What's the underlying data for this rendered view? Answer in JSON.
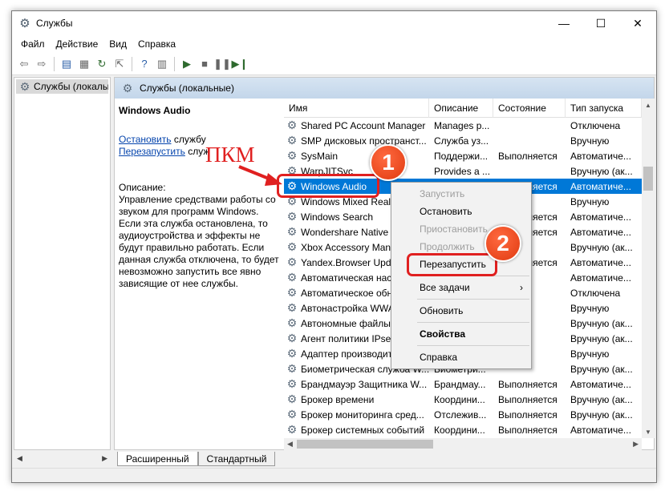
{
  "window": {
    "title": "Службы",
    "controls": {
      "minimize": "—",
      "maximize": "☐",
      "close": "✕"
    }
  },
  "menu": [
    "Файл",
    "Действие",
    "Вид",
    "Справка"
  ],
  "left_pane": {
    "tree_item": "Службы (локалы"
  },
  "right_pane": {
    "header": "Службы (локальные)",
    "detail": {
      "service_name": "Windows Audio",
      "stop_link": "Остановить",
      "stop_suffix": " службу",
      "restart_link": "Перезапустить",
      "restart_suffix": " служ",
      "description_title": "Описание:",
      "description_text": "Управление средствами работы со звуком для программ Windows. Если эта служба остановлена, то аудиоустройства и эффекты не будут правильно работать.  Если данная служба отключена, то будет невозможно запустить все явно зависящие от нее службы."
    }
  },
  "table": {
    "columns": [
      "Имя",
      "Описание",
      "Состояние",
      "Тип запуска"
    ],
    "rows": [
      {
        "name": "Shared PC Account Manager",
        "desc": "Manages p...",
        "state": "",
        "start": "Отключена"
      },
      {
        "name": "SMP дисковых пространст...",
        "desc": "Служба уз...",
        "state": "",
        "start": "Вручную"
      },
      {
        "name": "SysMain",
        "desc": "Поддержи...",
        "state": "Выполняется",
        "start": "Автоматиче..."
      },
      {
        "name": "WarpJITSvc",
        "desc": "Provides a ...",
        "state": "",
        "start": "Вручную (ак..."
      },
      {
        "name": "Windows Audio",
        "desc": "Управлен...",
        "state": "Выполняется",
        "start": "Автоматиче..."
      },
      {
        "name": "Windows Mixed Reali",
        "desc": "",
        "state": "",
        "start": "Вручную"
      },
      {
        "name": "Windows Search",
        "desc": "",
        "state": "Выполняется",
        "start": "Автоматиче..."
      },
      {
        "name": "Wondershare Native I",
        "desc": "",
        "state": "Выполняется",
        "start": "Автоматиче..."
      },
      {
        "name": "Xbox Accessory Mana",
        "desc": "",
        "state": "",
        "start": "Вручную (ак..."
      },
      {
        "name": "Yandex.Browser Upda",
        "desc": "",
        "state": "Выполняется",
        "start": "Автоматиче..."
      },
      {
        "name": "Автоматическая наст",
        "desc": "",
        "state": "",
        "start": "Автоматиче..."
      },
      {
        "name": "Автоматическое обн",
        "desc": "",
        "state": "",
        "start": "Отключена"
      },
      {
        "name": "Автонастройка WWA",
        "desc": "",
        "state": "",
        "start": "Вручную"
      },
      {
        "name": "Автономные файлы",
        "desc": "",
        "state": "",
        "start": "Вручную (ак..."
      },
      {
        "name": "Агент политики IPse",
        "desc": "",
        "state": "",
        "start": "Вручную (ак..."
      },
      {
        "name": "Адаптер производит",
        "desc": "",
        "state": "",
        "start": "Вручную"
      },
      {
        "name": "Биометрическая служба W...",
        "desc": "Биометри...",
        "state": "",
        "start": "Вручную (ак..."
      },
      {
        "name": "Брандмауэр Защитника W...",
        "desc": "Брандмау...",
        "state": "Выполняется",
        "start": "Автоматиче..."
      },
      {
        "name": "Брокер времени",
        "desc": "Координи...",
        "state": "Выполняется",
        "start": "Вручную (ак..."
      },
      {
        "name": "Брокер мониторинга сред...",
        "desc": "Отслежив...",
        "state": "Выполняется",
        "start": "Вручную (ак..."
      },
      {
        "name": "Брокер системных событий",
        "desc": "Координи...",
        "state": "Выполняется",
        "start": "Автоматиче..."
      }
    ]
  },
  "context_menu": [
    {
      "label": "Запустить",
      "disabled": true
    },
    {
      "label": "Остановить",
      "disabled": false
    },
    {
      "label": "Приостановить",
      "disabled": true
    },
    {
      "label": "Продолжить",
      "disabled": true
    },
    {
      "label": "Перезапустить",
      "disabled": false
    },
    {
      "sep": true
    },
    {
      "label": "Все задачи",
      "disabled": false,
      "submenu": true
    },
    {
      "sep": true
    },
    {
      "label": "Обновить",
      "disabled": false
    },
    {
      "sep": true
    },
    {
      "label": "Свойства",
      "disabled": false,
      "bold": true
    },
    {
      "sep": true
    },
    {
      "label": "Справка",
      "disabled": false
    }
  ],
  "tabs": [
    "Расширенный",
    "Стандартный"
  ],
  "annotations": {
    "pkm": "ПКМ",
    "badge1": "1",
    "badge2": "2",
    "color": "#e02020"
  }
}
